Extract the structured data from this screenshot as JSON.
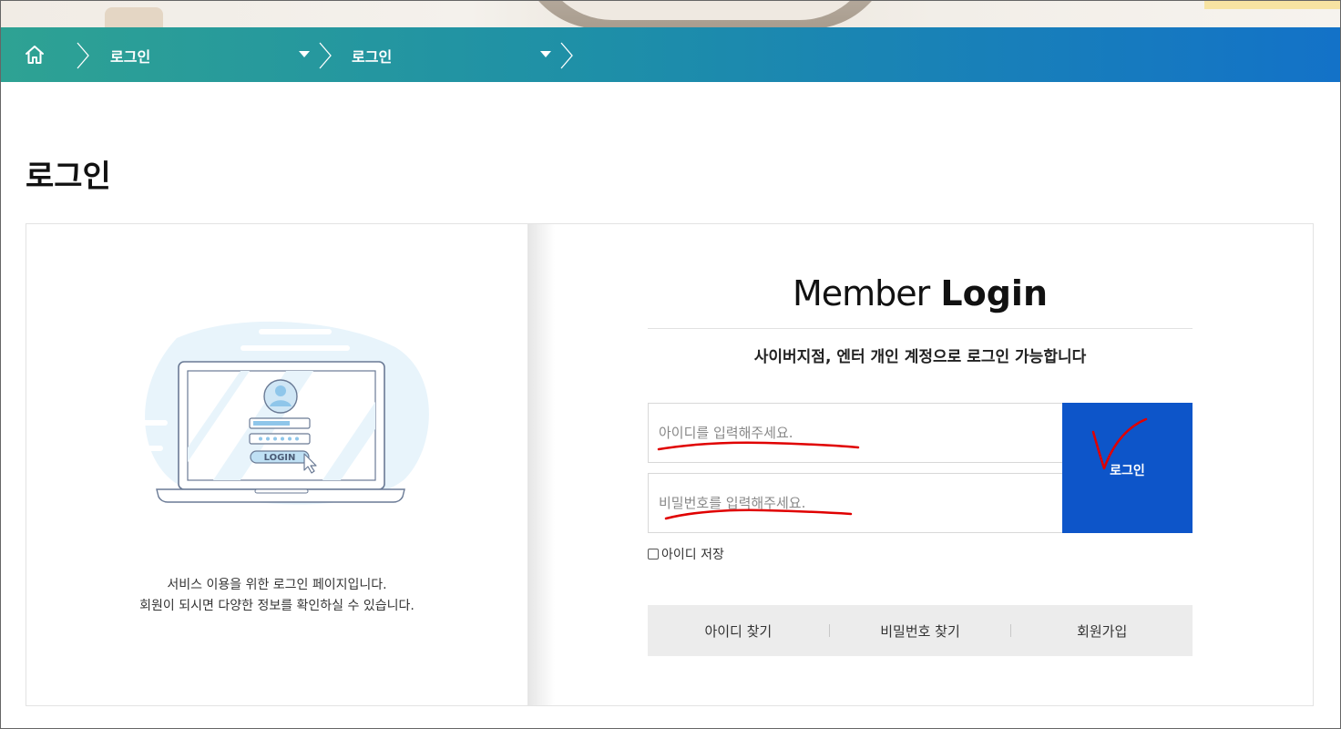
{
  "breadcrumb": {
    "home_icon": "home-icon",
    "level1": "로그인",
    "level2": "로그인"
  },
  "page_title": "로그인",
  "left": {
    "illustration_button": "LOGIN",
    "desc_line1": "서비스 이용을 위한 로그인 페이지입니다.",
    "desc_line2": "회원이 되시면 다양한 정보를 확인하실 수 있습니다."
  },
  "login": {
    "title_light": "Member",
    "title_bold": "Login",
    "subtitle": "사이버지점, 엔터 개인 계정으로 로그인 가능합니다",
    "id_placeholder": "아이디를 입력해주세요.",
    "pw_placeholder": "비밀번호를 입력해주세요.",
    "submit_label": "로그인",
    "save_id_label": "아이디 저장"
  },
  "links": {
    "find_id": "아이디 찾기",
    "find_pw": "비밀번호 찾기",
    "signup": "회원가입"
  },
  "colors": {
    "bar_start": "#2ea293",
    "bar_end": "#1372c8",
    "login_button": "#0d55c9",
    "annotation": "#e00000"
  }
}
